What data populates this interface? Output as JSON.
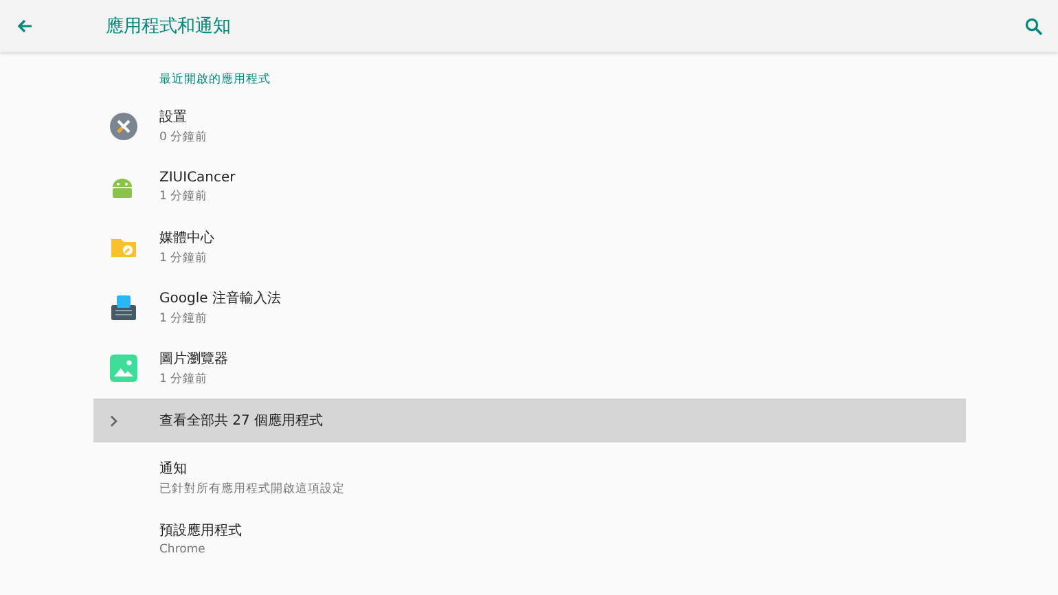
{
  "app_bar": {
    "title": "應用程式和通知"
  },
  "recent_apps": {
    "heading": "最近開啟的應用程式",
    "items": [
      {
        "kind": "settings",
        "name": "設置",
        "time": "0 分鐘前"
      },
      {
        "kind": "android",
        "name": "ZIUICancer",
        "time": "1 分鐘前"
      },
      {
        "kind": "folder",
        "name": "媒體中心",
        "time": "1 分鐘前"
      },
      {
        "kind": "keyboard",
        "name": "Google 注音輸入法",
        "time": "1 分鐘前"
      },
      {
        "kind": "gallery",
        "name": "圖片瀏覽器",
        "time": "1 分鐘前"
      }
    ],
    "see_all": {
      "label": "查看全部共 27 個應用程式",
      "selected": true
    }
  },
  "settings": [
    {
      "title": "通知",
      "summary": "已針對所有應用程式開啟這項設定"
    },
    {
      "title": "預設應用程式",
      "summary": "Chrome"
    }
  ]
}
